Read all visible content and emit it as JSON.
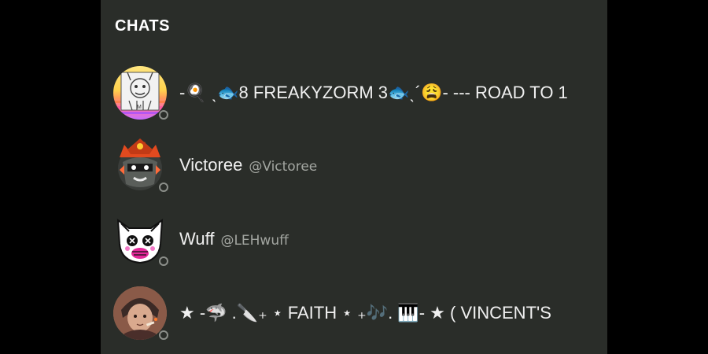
{
  "header": {
    "title": "CHATS"
  },
  "chats": [
    {
      "display_name": "-🍳 ˎ🐟8 FREAKYZORM 3🐟ˎ´😩- --- ROAD TO 1",
      "username": "",
      "status": "offline"
    },
    {
      "display_name": "Victoree",
      "username": "@Victoree",
      "status": "offline"
    },
    {
      "display_name": "Wuff",
      "username": "@LEHwuff",
      "status": "offline"
    },
    {
      "display_name": "★ -🦈 .🔪₊ ⋆ FAITH ⋆ ₊🎶. 🎹- ★ ( VINCENT'S",
      "username": "",
      "status": "offline"
    }
  ]
}
